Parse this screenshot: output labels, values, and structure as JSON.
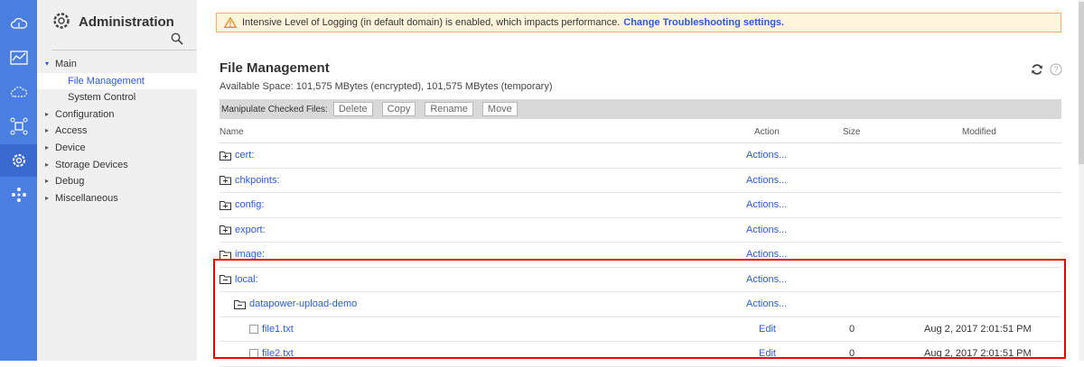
{
  "nav": {
    "title": "Administration",
    "items": [
      {
        "label": "Main",
        "arrow": "▾"
      },
      {
        "label": "File Management",
        "arrow": ""
      },
      {
        "label": "System Control",
        "arrow": ""
      },
      {
        "label": "Configuration",
        "arrow": "▸"
      },
      {
        "label": "Access",
        "arrow": "▸"
      },
      {
        "label": "Device",
        "arrow": "▸"
      },
      {
        "label": "Storage Devices",
        "arrow": "▸"
      },
      {
        "label": "Debug",
        "arrow": "▸"
      },
      {
        "label": "Miscellaneous",
        "arrow": "▸"
      }
    ]
  },
  "alert": {
    "text": "Intensive Level of Logging (in default domain) is enabled, which impacts performance.",
    "link": "Change Troubleshooting settings."
  },
  "page": {
    "title": "File Management",
    "space": "Available Space: 101,575 MBytes (encrypted), 101,575 MBytes (temporary)"
  },
  "toolbar": {
    "label": "Manipulate Checked Files:",
    "delete": "Delete",
    "copy": "Copy",
    "rename": "Rename",
    "move": "Move"
  },
  "columns": {
    "name": "Name",
    "action": "Action",
    "size": "Size",
    "modified": "Modified"
  },
  "rows": [
    {
      "name": "cert:",
      "action": "Actions...",
      "size": "",
      "modified": ""
    },
    {
      "name": "chkpoints:",
      "action": "Actions...",
      "size": "",
      "modified": ""
    },
    {
      "name": "config:",
      "action": "Actions...",
      "size": "",
      "modified": ""
    },
    {
      "name": "export:",
      "action": "Actions...",
      "size": "",
      "modified": ""
    },
    {
      "name": "image:",
      "action": "Actions...",
      "size": "",
      "modified": ""
    },
    {
      "name": "local:",
      "action": "Actions...",
      "size": "",
      "modified": ""
    },
    {
      "name": "datapower-upload-demo",
      "action": "Actions...",
      "size": "",
      "modified": ""
    },
    {
      "name": "file1.txt",
      "action": "Edit",
      "size": "0",
      "modified": "Aug 2, 2017 2:01:51 PM"
    },
    {
      "name": "file2.txt",
      "action": "Edit",
      "size": "0",
      "modified": "Aug 2, 2017 2:01:51 PM"
    }
  ],
  "colors": {
    "rail": "#4a7ee0",
    "link": "#2a5bd7",
    "highlight": "#e00000",
    "alert_bg": "#fff4dc"
  },
  "icons": [
    "cloud-upload-icon",
    "chart-icon",
    "cloud-network-icon",
    "network-icon",
    "gear-icon",
    "apps-icon"
  ]
}
